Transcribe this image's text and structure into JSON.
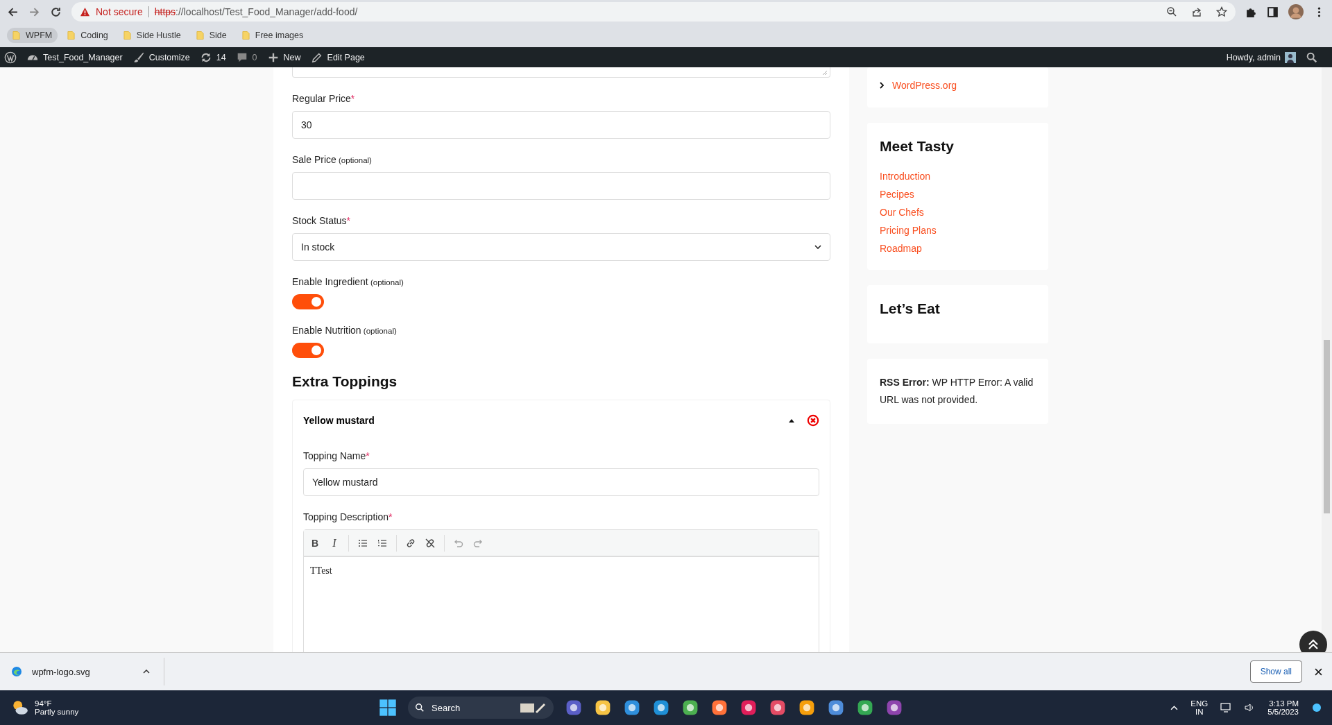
{
  "browser": {
    "security": "Not secure",
    "url_scheme": "https",
    "url_rest": "://localhost/Test_Food_Manager/add-food/"
  },
  "bookmarks": [
    {
      "label": "WPFM",
      "selected": true
    },
    {
      "label": "Coding",
      "selected": false
    },
    {
      "label": "Side Hustle",
      "selected": false
    },
    {
      "label": "Side",
      "selected": false
    },
    {
      "label": "Free images",
      "selected": false
    }
  ],
  "admin_bar": {
    "site": "Test_Food_Manager",
    "customize": "Customize",
    "updates": "14",
    "comments": "0",
    "new": "New",
    "edit": "Edit Page",
    "greeting": "Howdy, admin"
  },
  "form": {
    "fields": [
      {
        "kind": "text",
        "label": "Regular Price",
        "required_mark": "*",
        "value": "30"
      },
      {
        "kind": "text",
        "label": "Sale Price",
        "optional_note": "(optional)"
      },
      {
        "kind": "select",
        "label": "Stock Status",
        "required_mark": "*",
        "value": "In stock"
      },
      {
        "kind": "toggle",
        "label": "Enable Ingredient",
        "optional_note": "(optional)",
        "on": true
      },
      {
        "kind": "toggle",
        "label": "Enable Nutrition",
        "optional_note": "(optional)",
        "on": true
      }
    ],
    "toppings_heading": "Extra Toppings",
    "toppings": [
      {
        "title": "Yellow mustard",
        "expanded": true,
        "name_label": "Topping Name",
        "name_required_mark": "*",
        "name_value": "Yellow mustard",
        "desc_label": "Topping Description",
        "desc_required_mark": "*",
        "desc_text": "TTest"
      }
    ],
    "editor_tools": [
      {
        "kind": "bold",
        "glyph": "B",
        "disabled": false
      },
      {
        "kind": "italic",
        "glyph": "I",
        "disabled": false
      },
      {
        "kind": "bullets",
        "disabled": false
      },
      {
        "kind": "numbers",
        "disabled": false
      },
      {
        "kind": "link",
        "disabled": false
      },
      {
        "kind": "unlink",
        "disabled": false
      },
      {
        "kind": "undo",
        "disabled": true
      },
      {
        "kind": "redo",
        "disabled": true
      }
    ]
  },
  "sidebar": {
    "links_tail": [
      "WordPress.org"
    ],
    "meet_title": "Meet Tasty",
    "meet_links": [
      "Introduction",
      "Pecipes",
      "Our Chefs",
      "Pricing Plans",
      "Roadmap"
    ],
    "eat_title": "Let’s Eat",
    "rss_bold": "RSS Error:",
    "rss_text": "WP HTTP Error: A valid URL was not provided."
  },
  "download": {
    "file": "wpfm-logo.svg",
    "show_all": "Show all"
  },
  "taskbar": {
    "temp": "94°F",
    "weather": "Partly sunny",
    "search": "Search",
    "lang": "ENG",
    "region": "IN",
    "time": "3:13 PM",
    "date": "5/5/2023"
  }
}
